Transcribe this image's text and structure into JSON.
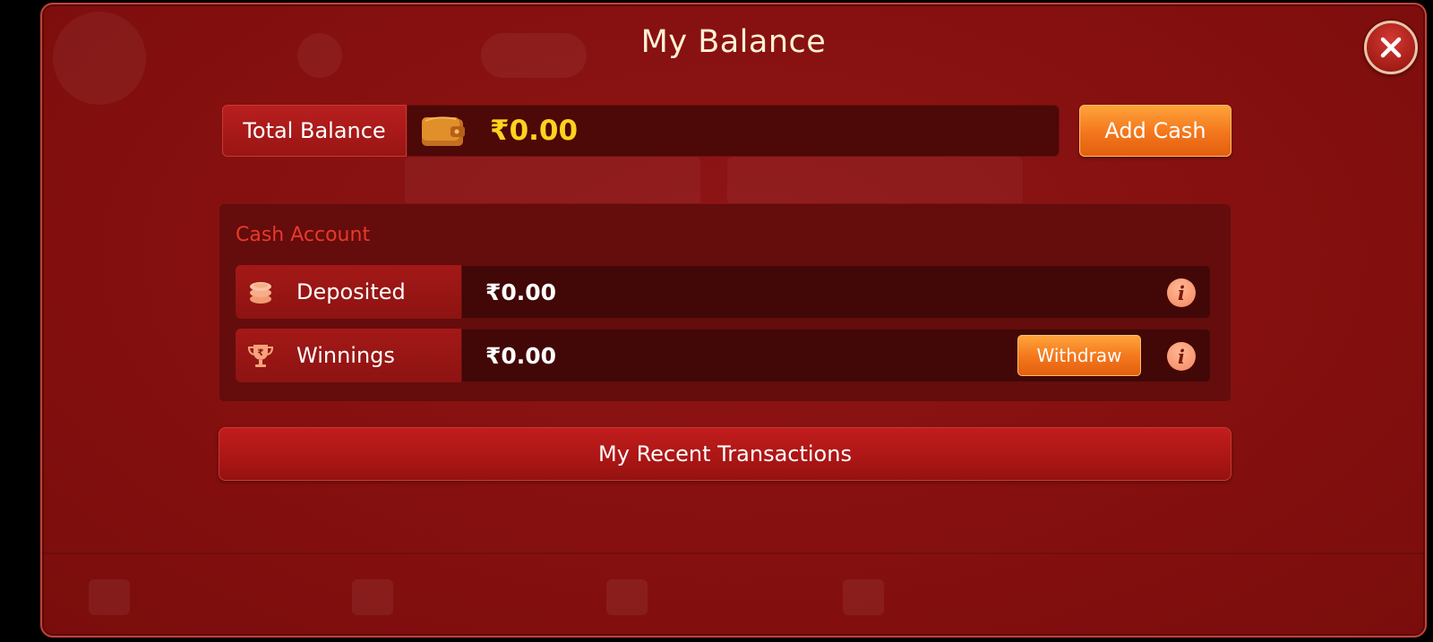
{
  "modal": {
    "title": "My Balance",
    "close_icon": "close-icon"
  },
  "balance": {
    "label": "Total Balance",
    "wallet_icon": "wallet-icon",
    "value": "₹0.00",
    "add_cash_label": "Add Cash"
  },
  "cash_account": {
    "title": "Cash Account",
    "rows": [
      {
        "icon": "coins-icon",
        "label": "Deposited",
        "value": "₹0.00",
        "info_icon": "i"
      },
      {
        "icon": "trophy-icon",
        "label": "Winnings",
        "value": "₹0.00",
        "withdraw_label": "Withdraw",
        "info_icon": "i"
      }
    ]
  },
  "recent_transactions_label": "My Recent Transactions",
  "colors": {
    "background": "#85100f",
    "balance_value": "#ffd21e",
    "accent_orange": "#f3761c",
    "section_title": "#e63a2a"
  }
}
